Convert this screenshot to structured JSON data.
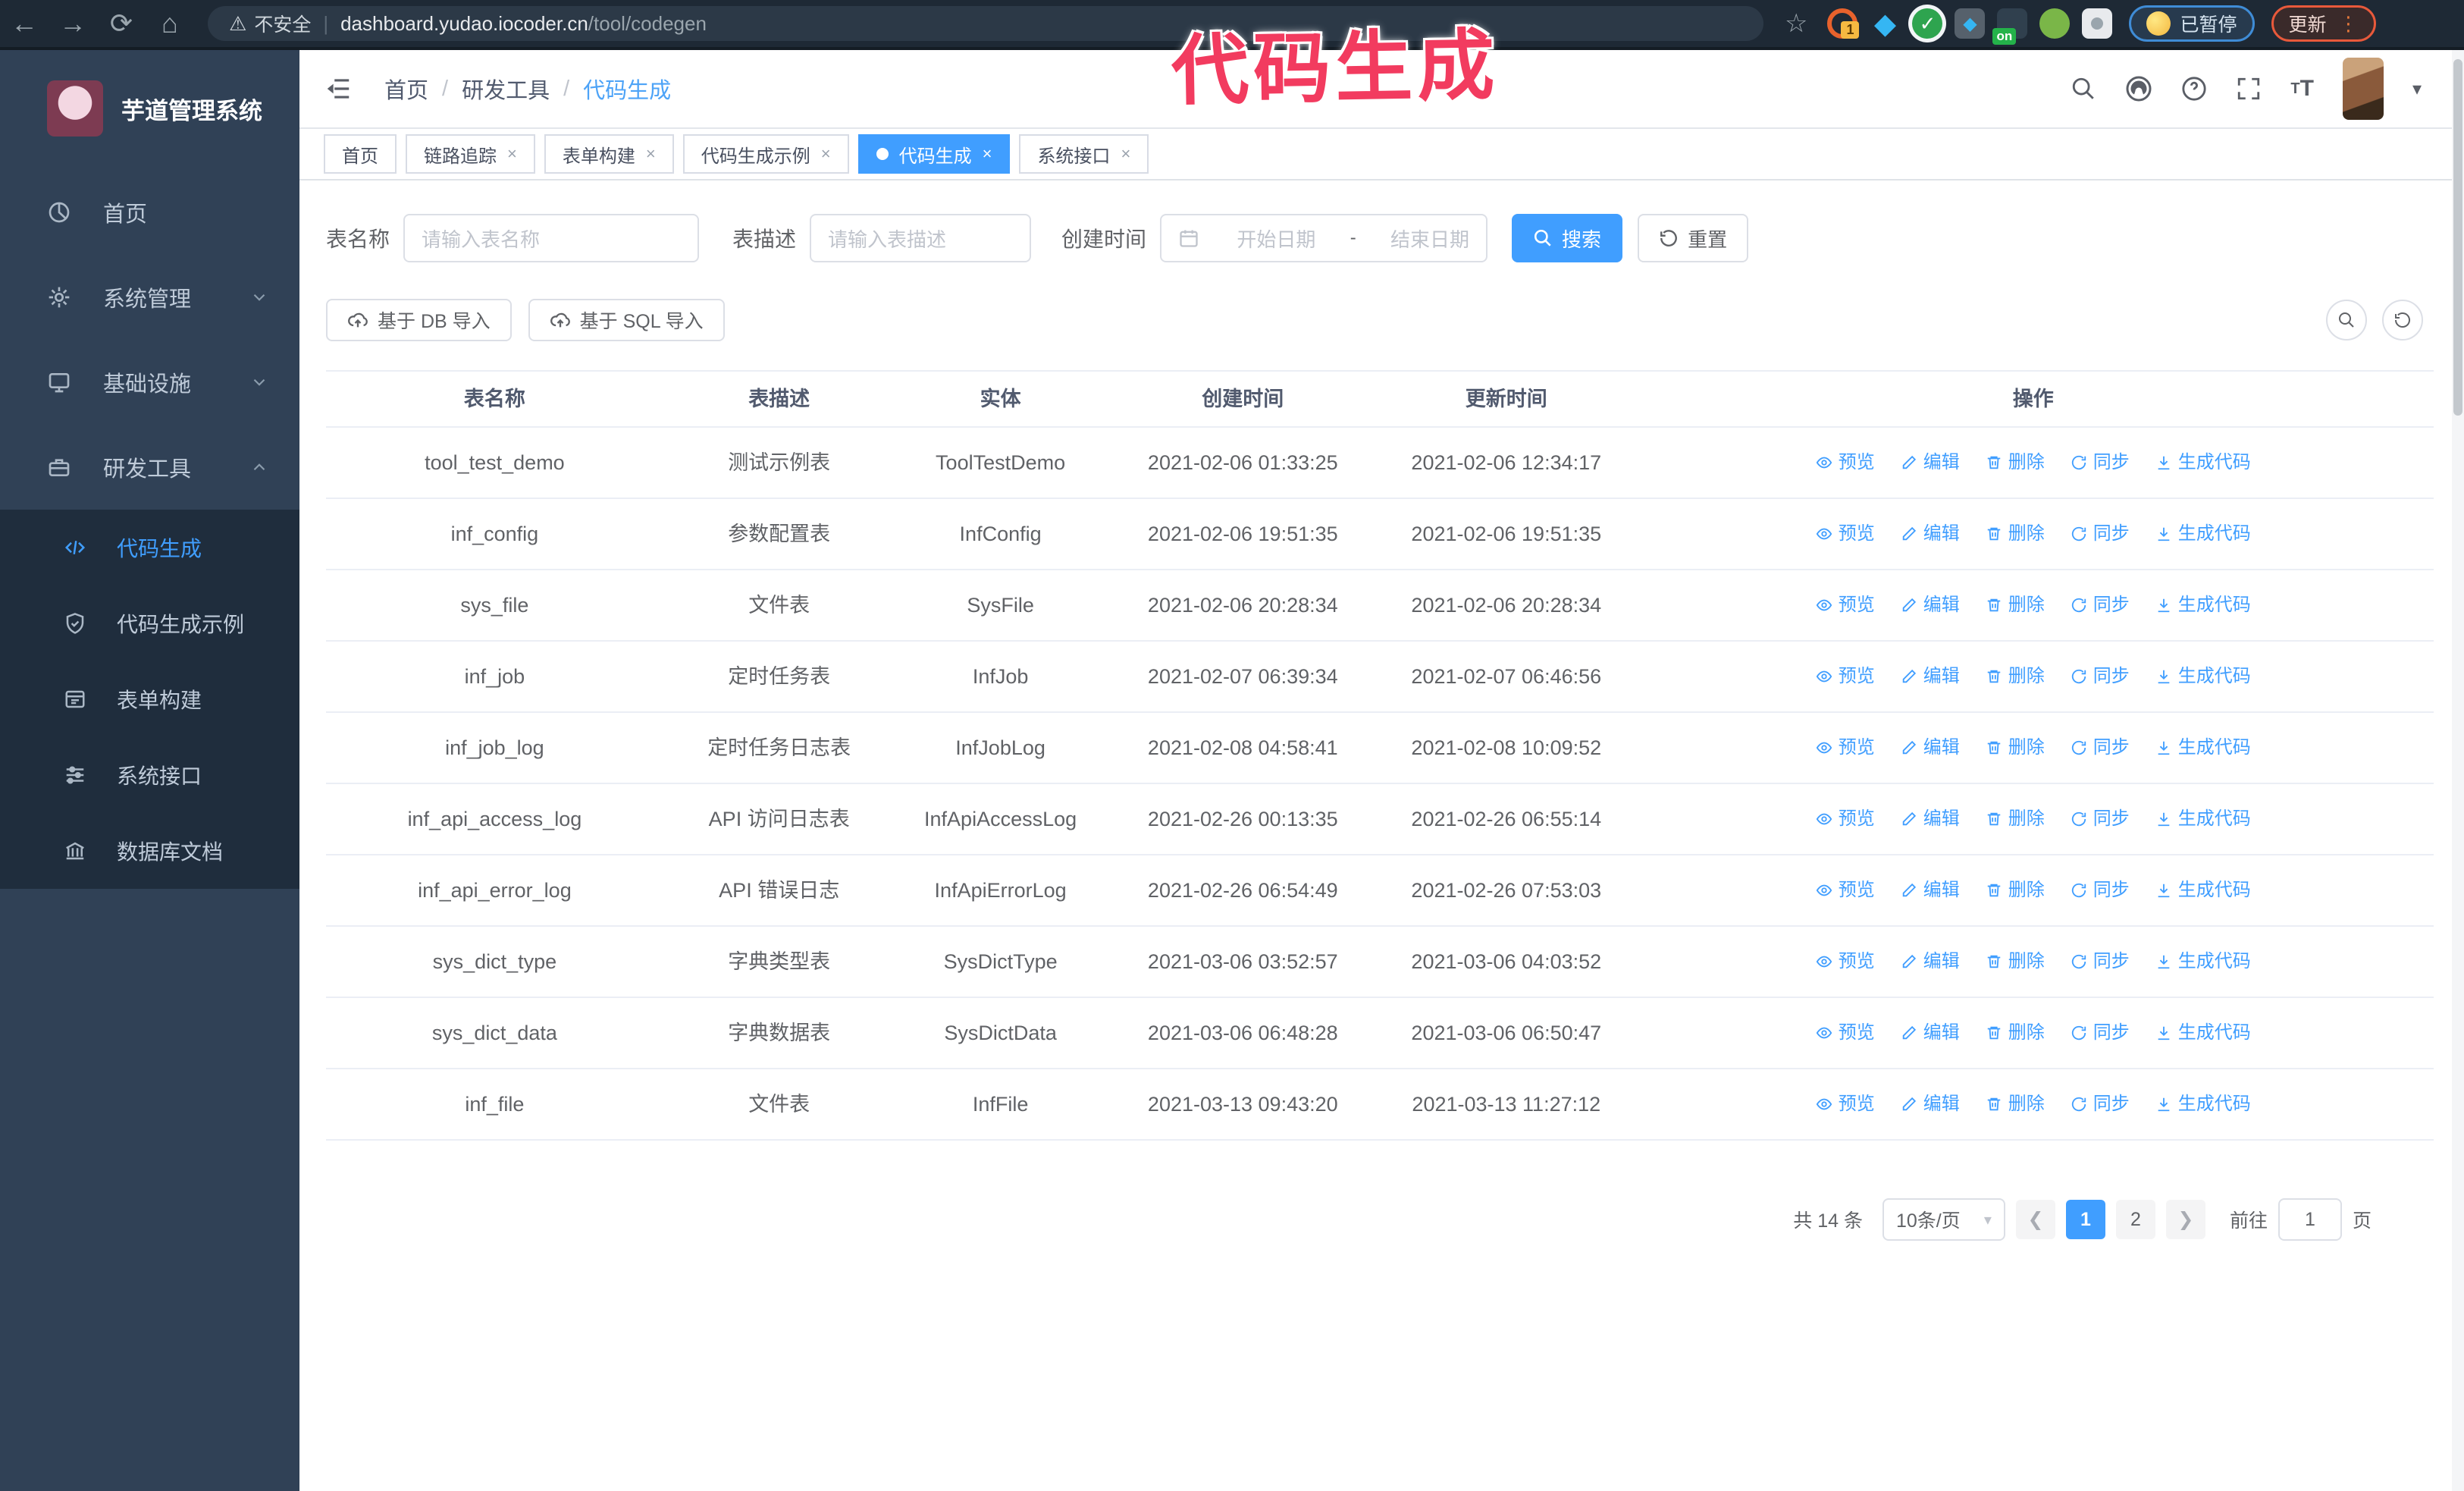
{
  "browser": {
    "warning_text": "不安全",
    "url_host": "dashboard.yudao.iocoder.cn",
    "url_path": "/tool/codegen",
    "extension_badge": "1",
    "extension_on_badge": "on",
    "paused_badge": "已暂停",
    "update_badge": "更新"
  },
  "annotation": {
    "text": "代码生成",
    "color": "#f23b5f"
  },
  "sidebar": {
    "title": "芋道管理系统",
    "items": [
      {
        "label": "首页",
        "icon": "dashboard-icon",
        "arrow": "none"
      },
      {
        "label": "系统管理",
        "icon": "gear-icon",
        "arrow": "down"
      },
      {
        "label": "基础设施",
        "icon": "monitor-icon",
        "arrow": "down"
      },
      {
        "label": "研发工具",
        "icon": "toolbox-icon",
        "arrow": "up"
      }
    ],
    "submenu": [
      {
        "label": "代码生成",
        "icon": "code-icon",
        "active": true
      },
      {
        "label": "代码生成示例",
        "icon": "shield-check-icon",
        "active": false
      },
      {
        "label": "表单构建",
        "icon": "form-icon",
        "active": false
      },
      {
        "label": "系统接口",
        "icon": "sliders-icon",
        "active": false
      },
      {
        "label": "数据库文档",
        "icon": "database-doc-icon",
        "active": false
      }
    ]
  },
  "header": {
    "breadcrumb": [
      "首页",
      "研发工具",
      "代码生成"
    ]
  },
  "tabs": [
    {
      "label": "首页",
      "closable": false,
      "active": false
    },
    {
      "label": "链路追踪",
      "closable": true,
      "active": false
    },
    {
      "label": "表单构建",
      "closable": true,
      "active": false
    },
    {
      "label": "代码生成示例",
      "closable": true,
      "active": false
    },
    {
      "label": "代码生成",
      "closable": true,
      "active": true
    },
    {
      "label": "系统接口",
      "closable": true,
      "active": false
    }
  ],
  "filters": {
    "name_label": "表名称",
    "name_placeholder": "请输入表名称",
    "desc_label": "表描述",
    "desc_placeholder": "请输入表描述",
    "time_label": "创建时间",
    "start_placeholder": "开始日期",
    "range_separator": "-",
    "end_placeholder": "结束日期",
    "search_label": "搜索",
    "reset_label": "重置"
  },
  "toolbar": {
    "import_db_label": "基于 DB 导入",
    "import_sql_label": "基于 SQL 导入"
  },
  "table": {
    "columns": [
      "表名称",
      "表描述",
      "实体",
      "创建时间",
      "更新时间",
      "操作"
    ],
    "actions": [
      {
        "key": "preview",
        "label": "预览",
        "icon": "eye-icon"
      },
      {
        "key": "edit",
        "label": "编辑",
        "icon": "pencil-icon"
      },
      {
        "key": "delete",
        "label": "删除",
        "icon": "trash-icon"
      },
      {
        "key": "sync",
        "label": "同步",
        "icon": "sync-icon"
      },
      {
        "key": "generate",
        "label": "生成代码",
        "icon": "download-icon"
      }
    ],
    "rows": [
      {
        "name": "tool_test_demo",
        "desc": "测试示例表",
        "entity": "ToolTestDemo",
        "created": "2021-02-06 01:33:25",
        "updated": "2021-02-06 12:34:17"
      },
      {
        "name": "inf_config",
        "desc": "参数配置表",
        "entity": "InfConfig",
        "created": "2021-02-06 19:51:35",
        "updated": "2021-02-06 19:51:35"
      },
      {
        "name": "sys_file",
        "desc": "文件表",
        "entity": "SysFile",
        "created": "2021-02-06 20:28:34",
        "updated": "2021-02-06 20:28:34"
      },
      {
        "name": "inf_job",
        "desc": "定时任务表",
        "entity": "InfJob",
        "created": "2021-02-07 06:39:34",
        "updated": "2021-02-07 06:46:56"
      },
      {
        "name": "inf_job_log",
        "desc": "定时任务日志表",
        "entity": "InfJobLog",
        "created": "2021-02-08 04:58:41",
        "updated": "2021-02-08 10:09:52"
      },
      {
        "name": "inf_api_access_log",
        "desc": "API 访问日志表",
        "entity": "InfApiAccessLog",
        "created": "2021-02-26 00:13:35",
        "updated": "2021-02-26 06:55:14"
      },
      {
        "name": "inf_api_error_log",
        "desc": "API 错误日志",
        "entity": "InfApiErrorLog",
        "created": "2021-02-26 06:54:49",
        "updated": "2021-02-26 07:53:03"
      },
      {
        "name": "sys_dict_type",
        "desc": "字典类型表",
        "entity": "SysDictType",
        "created": "2021-03-06 03:52:57",
        "updated": "2021-03-06 04:03:52"
      },
      {
        "name": "sys_dict_data",
        "desc": "字典数据表",
        "entity": "SysDictData",
        "created": "2021-03-06 06:48:28",
        "updated": "2021-03-06 06:50:47"
      },
      {
        "name": "inf_file",
        "desc": "文件表",
        "entity": "InfFile",
        "created": "2021-03-13 09:43:20",
        "updated": "2021-03-13 11:27:12"
      }
    ]
  },
  "pagination": {
    "total_text": "共 14 条",
    "page_size": "10条/页",
    "pages": [
      "1",
      "2"
    ],
    "active_page": "1",
    "goto_label": "前往",
    "goto_value": "1",
    "goto_suffix": "页"
  },
  "colors": {
    "accent": "#409eff",
    "annotation": "#f23b5f",
    "sidebar_bg": "#304156",
    "submenu_bg": "#1f2d3d",
    "browser_bar_bg": "#1e2935"
  }
}
